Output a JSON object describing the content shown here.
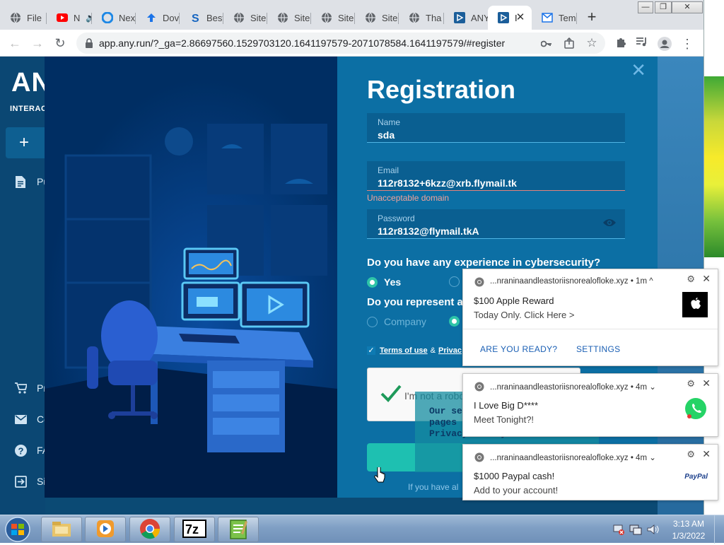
{
  "browser": {
    "tabs": [
      {
        "label": "File",
        "icon": "globe-icon"
      },
      {
        "label": "N",
        "icon": "youtube-icon"
      },
      {
        "label": "Nex",
        "icon": "blue-circle-icon"
      },
      {
        "label": "Dov",
        "icon": "upload-icon"
      },
      {
        "label": "Best",
        "icon": "s-icon"
      },
      {
        "label": "Site",
        "icon": "globe-icon"
      },
      {
        "label": "Site",
        "icon": "globe-icon"
      },
      {
        "label": "Site",
        "icon": "globe-icon"
      },
      {
        "label": "Site",
        "icon": "globe-icon"
      },
      {
        "label": "Tha",
        "icon": "globe-icon"
      },
      {
        "label": "ANY",
        "icon": "anyrun-icon"
      },
      {
        "label": "I",
        "icon": "anyrun-icon"
      },
      {
        "label": "Tem",
        "icon": "mail-icon"
      }
    ],
    "url": "app.any.run/?_ga=2.86697560.1529703120.1641197579-2071078584.1641197579/#register"
  },
  "sidebar": {
    "logo": "ANY",
    "subtitle": "INTERACTI",
    "new_task": "+",
    "items_top": [
      {
        "label": "Pu",
        "icon": "document-icon"
      }
    ],
    "items_bottom": [
      {
        "label": "Pr",
        "icon": "cart-icon"
      },
      {
        "label": "Co",
        "icon": "mail-icon"
      },
      {
        "label": "FA",
        "icon": "help-icon"
      },
      {
        "label": "Si",
        "icon": "signin-icon"
      }
    ]
  },
  "registration": {
    "title": "Registration",
    "close": "✕",
    "name_label": "Name",
    "name_value": "sda",
    "email_label": "Email",
    "email_value": "112r8132+6kzz@xrb.flymail.tk",
    "email_error": "Unacceptable domain",
    "password_label": "Password",
    "password_value": "112r8132@flymail.tkA",
    "q_experience": "Do you have any experience in cybersecurity?",
    "yes_label": "Yes",
    "q_represent": "Do you represent a",
    "company_label": "Company",
    "terms_label": "Terms of use",
    "amp": "&",
    "privacy_label": "Privac",
    "captcha_text": "I'm not a robot",
    "cookie_lines": [
      "Our se",
      "pages",
      "Privacy Policy"
    ],
    "login_hint": "If you have al"
  },
  "notifications": [
    {
      "site": "...nraninaandleastoriisnorealofloke.xyz",
      "time": "• 1m ^",
      "title": "$100 Apple Reward",
      "body": "Today Only. Click Here >",
      "image": "apple-logo-icon",
      "actions": [
        "ARE YOU READY?",
        "SETTINGS"
      ]
    },
    {
      "site": "...nraninaandleastoriisnorealofloke.xyz",
      "time": "• 4m ⌄",
      "title": "I Love Big D****",
      "body": "Meet Tonight?!",
      "image": "whatsapp-icon"
    },
    {
      "site": "...nraninaandleastoriisnorealofloke.xyz",
      "time": "• 4m ⌄",
      "title": "$1000 Paypal cash!",
      "body": "Add to your account!",
      "image": "paypal-icon",
      "image_text": "PayPal"
    }
  ],
  "taskbar": {
    "clock_time": "3:13 AM",
    "clock_date": "1/3/2022",
    "apps": [
      "explorer-icon",
      "media-player-icon",
      "chrome-icon",
      "7zip-icon",
      "notepad-icon"
    ]
  },
  "colors": {
    "modal_panel": "#0c6fa4",
    "illustration_bg": "#002e63",
    "accent_green": "#1ec0b1",
    "error": "#f2a29a"
  }
}
